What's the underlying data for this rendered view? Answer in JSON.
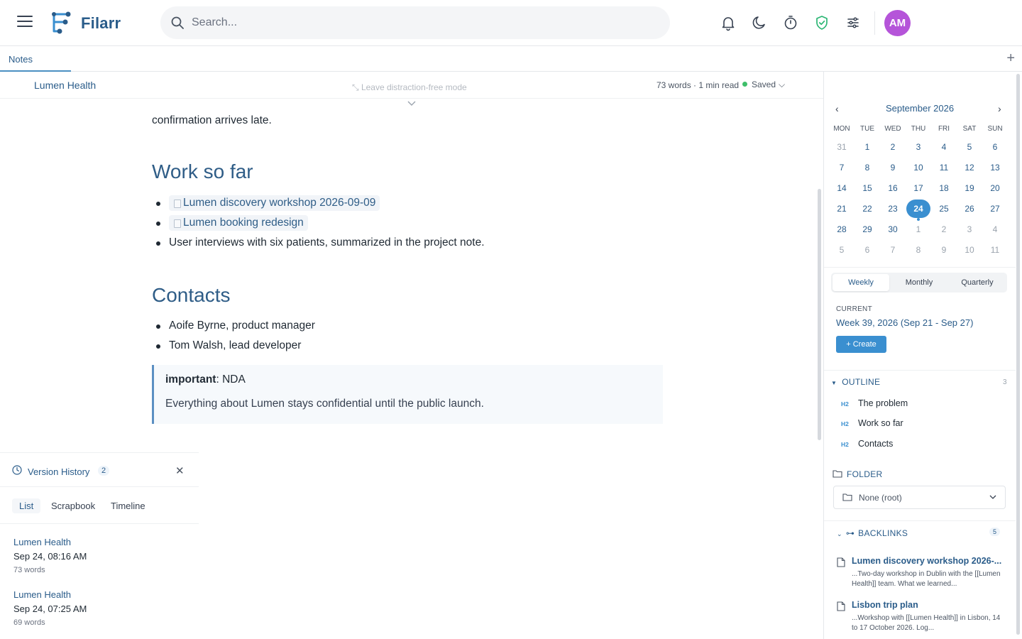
{
  "app": {
    "name": "Filarr"
  },
  "search": {
    "placeholder": "Search..."
  },
  "user": {
    "initials": "AM"
  },
  "tabs": {
    "notes": "Notes"
  },
  "editor": {
    "doc_title": "Lumen Health",
    "leave_mode": "Leave distraction-free mode",
    "word_count": "73 words · 1 min read",
    "saved": "Saved"
  },
  "doc": {
    "intro": "confirmation arrives late.",
    "h_work": "Work so far",
    "work_items": [
      "Lumen discovery workshop 2026-09-09",
      "Lumen booking redesign",
      "User interviews with six patients, summarized in the project note."
    ],
    "h_contacts": "Contacts",
    "contacts": [
      "Aoife Byrne, product manager",
      "Tom Walsh, lead developer"
    ],
    "callout_label": "important",
    "callout_title": ": NDA",
    "callout_body": "Everything about Lumen stays confidential until the public launch."
  },
  "version_history": {
    "title": "Version History",
    "count": "2",
    "tabs": [
      "List",
      "Scrapbook",
      "Timeline"
    ],
    "entries": [
      {
        "name": "Lumen Health",
        "date": "Sep 24, 08:16 AM",
        "words": "73 words"
      },
      {
        "name": "Lumen Health",
        "date": "Sep 24, 07:25 AM",
        "words": "69 words"
      }
    ]
  },
  "calendar": {
    "title": "September 2026",
    "dow": [
      "MON",
      "TUE",
      "WED",
      "THU",
      "FRI",
      "SAT",
      "SUN"
    ],
    "weeks": [
      [
        "31",
        "1",
        "2",
        "3",
        "4",
        "5",
        "6"
      ],
      [
        "7",
        "8",
        "9",
        "10",
        "11",
        "12",
        "13"
      ],
      [
        "14",
        "15",
        "16",
        "17",
        "18",
        "19",
        "20"
      ],
      [
        "21",
        "22",
        "23",
        "24",
        "25",
        "26",
        "27"
      ],
      [
        "28",
        "29",
        "30",
        "1",
        "2",
        "3",
        "4"
      ],
      [
        "5",
        "6",
        "7",
        "8",
        "9",
        "10",
        "11"
      ]
    ],
    "today": "24",
    "views": [
      "Weekly",
      "Monthly",
      "Quarterly"
    ],
    "current_label": "CURRENT",
    "current_week": "Week 39, 2026 (Sep 21 - Sep 27)",
    "create": "+ Create"
  },
  "outline": {
    "title": "OUTLINE",
    "count": "3",
    "tag": "H2",
    "items": [
      "The problem",
      "Work so far",
      "Contacts"
    ]
  },
  "folder": {
    "title": "FOLDER",
    "value": "None (root)"
  },
  "backlinks": {
    "title": "BACKLINKS",
    "count": "5",
    "items": [
      {
        "title": "Lumen discovery workshop 2026-...",
        "snippet": "...Two-day workshop in Dublin with the [[Lumen Health]] team. What we learned..."
      },
      {
        "title": "Lisbon trip plan",
        "snippet": "...Workshop with [[Lumen Health]] in Lisbon, 14 to 17 October 2026. Log..."
      }
    ]
  },
  "colors": {
    "accent": "#3a8fd0",
    "heading": "#2f5d87",
    "avatar": "#b554d9",
    "saved": "#3fbf6a",
    "shield": "#2bb673"
  }
}
